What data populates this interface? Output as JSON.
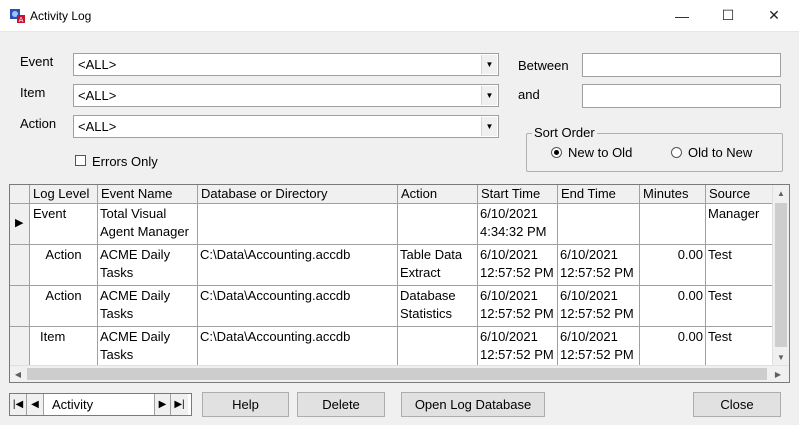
{
  "window": {
    "title": "Activity Log",
    "minimize": "—",
    "maximize": "☐",
    "close": "✕"
  },
  "filters": {
    "event": {
      "label": "Event",
      "value": "<ALL>"
    },
    "item": {
      "label": "Item",
      "value": "<ALL>"
    },
    "action": {
      "label": "Action",
      "value": "<ALL>"
    },
    "errors_only": {
      "label": "Errors Only",
      "checked": false
    },
    "between": {
      "label": "Between",
      "value": ""
    },
    "and": {
      "label": "and",
      "value": ""
    }
  },
  "sort_order": {
    "title": "Sort Order",
    "options": [
      {
        "label": "New to Old",
        "selected": true
      },
      {
        "label": "Old to New",
        "selected": false
      }
    ]
  },
  "grid": {
    "columns": [
      "Log Level",
      "Event Name",
      "Database or Directory",
      "Action",
      "Start Time",
      "End Time",
      "Minutes",
      "Source"
    ],
    "rows": [
      {
        "current": true,
        "log_level": "Event",
        "event_name": "Total Visual\nAgent Manager",
        "database": "",
        "action": "",
        "start": "6/10/2021\n4:34:32 PM",
        "end": "",
        "minutes": "",
        "source": "Manager"
      },
      {
        "current": false,
        "log_level": "Action",
        "event_name": "ACME Daily\nTasks",
        "database": "C:\\Data\\Accounting.accdb",
        "action": "Table Data\nExtract",
        "start": "6/10/2021\n12:57:52 PM",
        "end": "6/10/2021\n12:57:52 PM",
        "minutes": "0.00",
        "source": "Test"
      },
      {
        "current": false,
        "log_level": "Action",
        "event_name": "ACME Daily\nTasks",
        "database": "C:\\Data\\Accounting.accdb",
        "action": "Database\nStatistics",
        "start": "6/10/2021\n12:57:52 PM",
        "end": "6/10/2021\n12:57:52 PM",
        "minutes": "0.00",
        "source": "Test"
      },
      {
        "current": false,
        "log_level": "Item",
        "event_name": "ACME Daily\nTasks",
        "database": "C:\\Data\\Accounting.accdb",
        "action": "",
        "start": "6/10/2021\n12:57:52 PM",
        "end": "6/10/2021\n12:57:52 PM",
        "minutes": "0.00",
        "source": "Test"
      }
    ]
  },
  "navigator": {
    "value": "Activity"
  },
  "buttons": {
    "help": "Help",
    "delete": "Delete",
    "open_log": "Open Log Database",
    "close": "Close"
  },
  "colors": {
    "accent": "#000000",
    "window_bg": "#f0f0f0",
    "grid_bg": "#ffffff"
  }
}
